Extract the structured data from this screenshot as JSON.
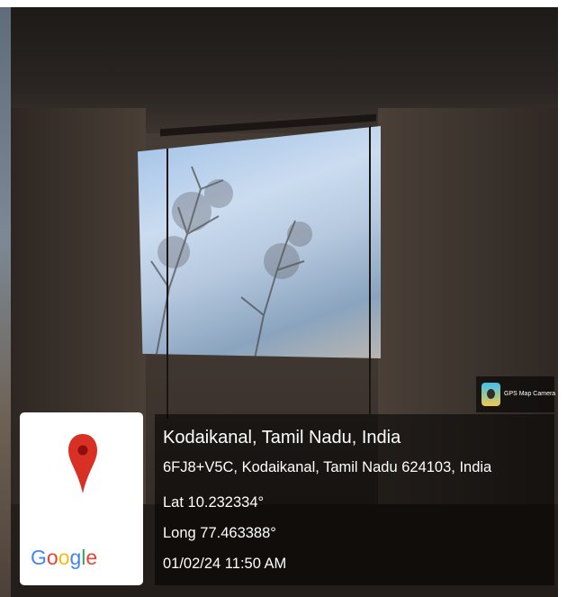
{
  "location": {
    "title": "Kodaikanal, Tamil Nadu, India",
    "address": "6FJ8+V5C, Kodaikanal, Tamil Nadu 624103, India",
    "latitude": "Lat 10.232334°",
    "longitude": "Long 77.463388°",
    "datetime": "01/02/24 11:50 AM"
  },
  "map_card": {
    "brand": "Google",
    "icon": "map-pin-icon",
    "colors": {
      "pin": "#d93025",
      "blue": "#4285f4",
      "red": "#ea4335",
      "yellow": "#fbbc05",
      "green": "#34a853"
    }
  },
  "app_badge": {
    "label": "GPS Map Camera",
    "icon": "gps-map-camera-icon"
  }
}
